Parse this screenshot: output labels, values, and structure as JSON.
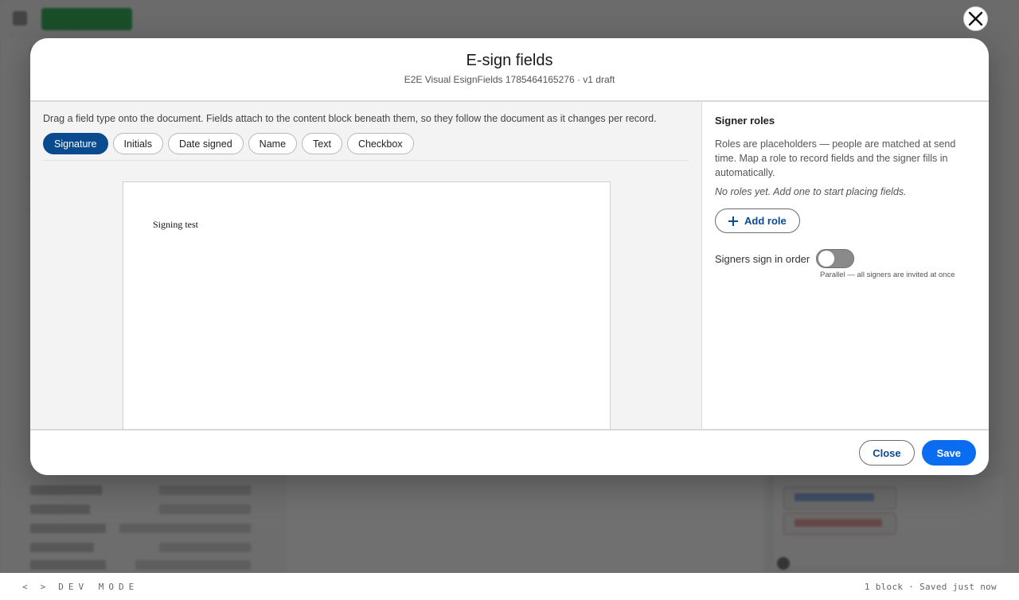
{
  "modal": {
    "title": "E-sign fields",
    "subtitle": "E2E Visual EsignFields 1785464165276 · v1 draft"
  },
  "editor": {
    "instructions": "Drag a field type onto the document. Fields attach to the content block beneath them, so they follow the document as it changes per record.",
    "field_types": [
      {
        "label": "Signature",
        "active": true
      },
      {
        "label": "Initials",
        "active": false
      },
      {
        "label": "Date signed",
        "active": false
      },
      {
        "label": "Name",
        "active": false
      },
      {
        "label": "Text",
        "active": false
      },
      {
        "label": "Checkbox",
        "active": false
      }
    ],
    "document_text": "Signing test"
  },
  "roles": {
    "title": "Signer roles",
    "description": "Roles are placeholders — people are matched at send time. Map a role to record fields and the signer fills in automatically.",
    "empty_state": "No roles yet. Add one to start placing fields.",
    "add_role_label": "Add role",
    "order_label": "Signers sign in order",
    "order_enabled": false,
    "order_hint": "Parallel — all signers are invited at once"
  },
  "footer": {
    "close_label": "Close",
    "save_label": "Save"
  },
  "devbar": {
    "nav_prev": "<",
    "nav_next": ">",
    "mode_label": "DEV MODE",
    "status": "1 block · Saved just now"
  },
  "colors": {
    "primary": "#0a6cf0",
    "active_chip": "#0a4a8f",
    "link": "#0a4a8f"
  }
}
